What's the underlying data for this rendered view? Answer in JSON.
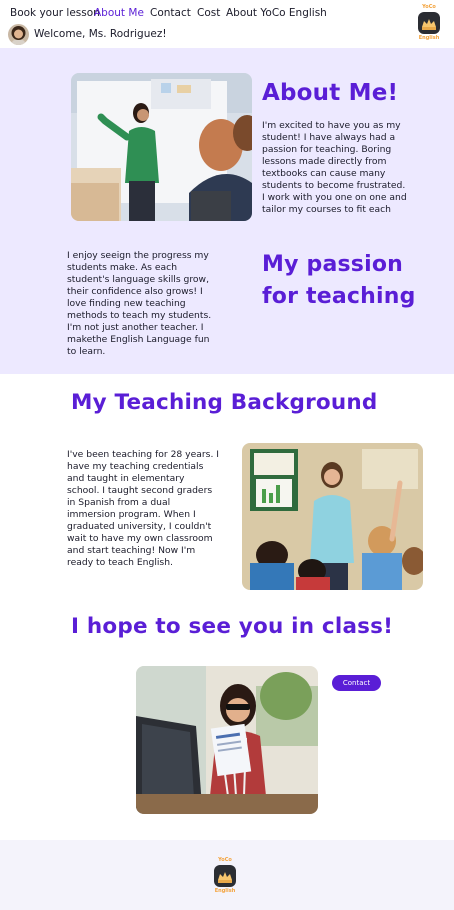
{
  "nav": {
    "items": [
      {
        "label": "Book your lesson"
      },
      {
        "label": "About Me",
        "active": true
      },
      {
        "label": "Contact"
      },
      {
        "label": "Cost"
      },
      {
        "label": "About YoCo English"
      }
    ]
  },
  "user": {
    "welcome": "Welcome, Ms. Rodriguez!"
  },
  "brand": {
    "logo_top": "YoCo",
    "logo_bottom": "English"
  },
  "about": {
    "title": "About Me!",
    "text": "I'm excited to have you as my student! I have always had a passion for teaching. Boring lessons made directly from textbooks can cause many students to become frustrated. I work with you one on one and tailor my courses to fit each"
  },
  "passion": {
    "title_line1": "My passion",
    "title_line2": "for teaching",
    "text": "I enjoy seeign the progress my students make. As each student's language skills grow, their confidence also grows! I love finding new teaching methods to teach my students. I'm not just another teacher. I makethe English Language fun to learn."
  },
  "background": {
    "title": "My Teaching Background",
    "text": "I've been teaching for 28 years.  I have my teaching credentials and taught in elementary school. I taught second graders in Spanish from a dual immersion program. When I graduated university, I couldn't wait to have my own classroom and start teaching! Now I'm ready to teach English."
  },
  "closing": {
    "title": "I hope to see you in class!",
    "contact_label": "Contact"
  },
  "colors": {
    "accent": "#5a1ed6",
    "hero_bg": "#ede9ff",
    "brand_orange": "#f3a23a"
  }
}
